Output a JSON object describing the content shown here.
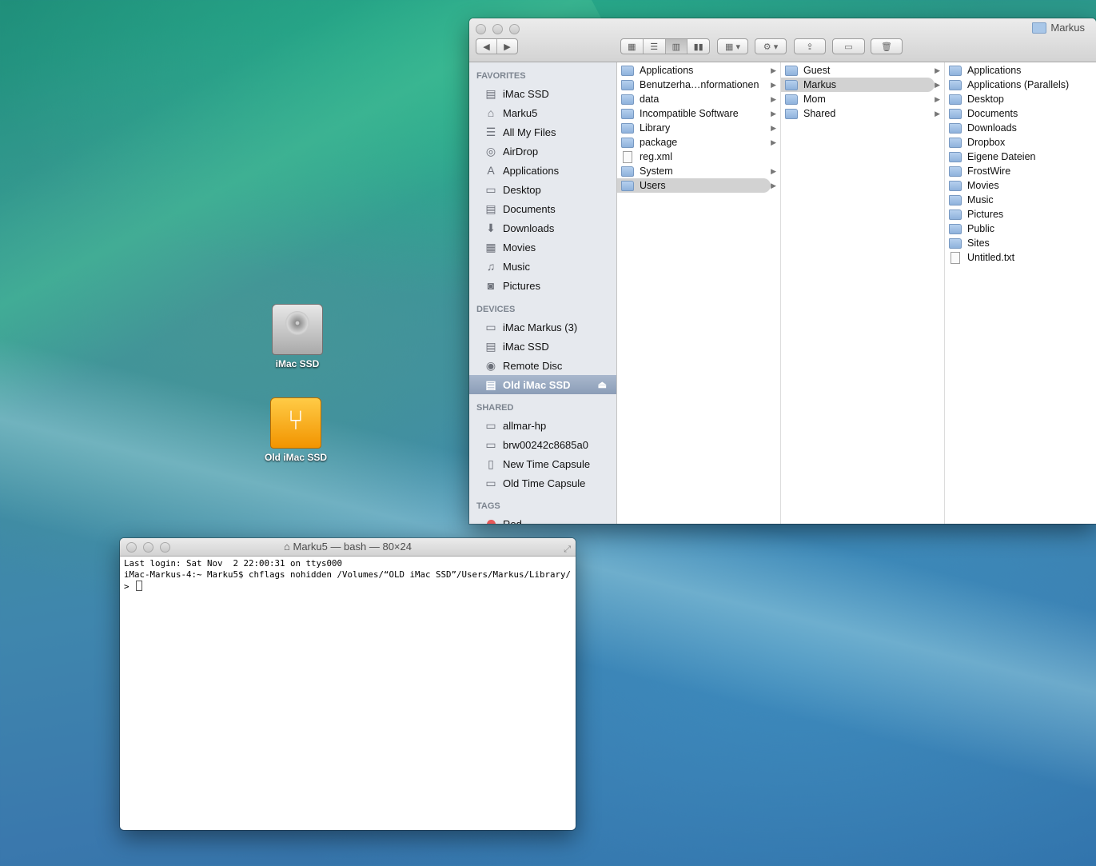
{
  "desktop": {
    "icons": [
      {
        "label": "iMac SSD",
        "kind": "hard-drive"
      },
      {
        "label": "Old iMac SSD",
        "kind": "usb-drive"
      }
    ]
  },
  "finder": {
    "title": "Markus",
    "toolbar": {
      "back": "◀",
      "forward": "▶",
      "views": [
        "icon-view",
        "list-view",
        "column-view",
        "coverflow-view"
      ],
      "active_view": "column-view",
      "arrange_icon": "▦",
      "action_icon": "⚙",
      "share_icon": "⇪",
      "tag_icon": "▭",
      "trash_icon": "🗑"
    },
    "sidebar": {
      "favorites_header": "FAVORITES",
      "favorites": [
        {
          "label": "iMac SSD",
          "icon": "internal-disk-icon",
          "glyph": "▤"
        },
        {
          "label": "Marku5",
          "icon": "home-icon",
          "glyph": "⌂"
        },
        {
          "label": "All My Files",
          "icon": "all-files-icon",
          "glyph": "☰"
        },
        {
          "label": "AirDrop",
          "icon": "airdrop-icon",
          "glyph": "◎"
        },
        {
          "label": "Applications",
          "icon": "applications-icon",
          "glyph": "A"
        },
        {
          "label": "Desktop",
          "icon": "desktop-icon",
          "glyph": "▭"
        },
        {
          "label": "Documents",
          "icon": "documents-icon",
          "glyph": "▤"
        },
        {
          "label": "Downloads",
          "icon": "downloads-icon",
          "glyph": "⬇"
        },
        {
          "label": "Movies",
          "icon": "movies-icon",
          "glyph": "▦"
        },
        {
          "label": "Music",
          "icon": "music-icon",
          "glyph": "♫"
        },
        {
          "label": "Pictures",
          "icon": "pictures-icon",
          "glyph": "◙"
        }
      ],
      "devices_header": "DEVICES",
      "devices": [
        {
          "label": "iMac Markus (3)",
          "icon": "imac-icon",
          "glyph": "▭"
        },
        {
          "label": "iMac SSD",
          "icon": "internal-disk-icon",
          "glyph": "▤"
        },
        {
          "label": "Remote Disc",
          "icon": "disc-icon",
          "glyph": "◉"
        },
        {
          "label": "Old iMac SSD",
          "icon": "external-disk-icon",
          "glyph": "▤",
          "selected": true,
          "eject": "⏏"
        }
      ],
      "shared_header": "SHARED",
      "shared": [
        {
          "label": "allmar-hp",
          "icon": "network-computer-icon",
          "glyph": "▭"
        },
        {
          "label": "brw00242c8685a0",
          "icon": "network-computer-icon",
          "glyph": "▭"
        },
        {
          "label": "New Time Capsule",
          "icon": "time-capsule-icon",
          "glyph": "▯"
        },
        {
          "label": "Old Time Capsule",
          "icon": "time-capsule-icon",
          "glyph": "▭"
        }
      ],
      "tags_header": "TAGS",
      "tags": [
        {
          "label": "Red",
          "color": "#e85a5a"
        }
      ]
    },
    "columns": [
      {
        "items": [
          {
            "label": "Applications",
            "type": "folder",
            "has_children": true
          },
          {
            "label": "Benutzerha…nformationen",
            "type": "folder-alias",
            "has_children": true
          },
          {
            "label": "data",
            "type": "folder",
            "has_children": true
          },
          {
            "label": "Incompatible Software",
            "type": "folder",
            "has_children": true
          },
          {
            "label": "Library",
            "type": "folder",
            "has_children": true
          },
          {
            "label": "package",
            "type": "folder",
            "has_children": true
          },
          {
            "label": "reg.xml",
            "type": "file",
            "has_children": false
          },
          {
            "label": "System",
            "type": "folder",
            "has_children": true
          },
          {
            "label": "Users",
            "type": "folder",
            "has_children": true,
            "selected": true
          }
        ]
      },
      {
        "items": [
          {
            "label": "Guest",
            "type": "folder",
            "has_children": true
          },
          {
            "label": "Markus",
            "type": "folder",
            "has_children": true,
            "selected": true
          },
          {
            "label": "Mom",
            "type": "folder",
            "has_children": true
          },
          {
            "label": "Shared",
            "type": "folder",
            "has_children": true
          }
        ]
      },
      {
        "items": [
          {
            "label": "Applications",
            "type": "folder"
          },
          {
            "label": "Applications (Parallels)",
            "type": "folder"
          },
          {
            "label": "Desktop",
            "type": "folder"
          },
          {
            "label": "Documents",
            "type": "folder"
          },
          {
            "label": "Downloads",
            "type": "folder"
          },
          {
            "label": "Dropbox",
            "type": "folder"
          },
          {
            "label": "Eigene Dateien",
            "type": "folder"
          },
          {
            "label": "FrostWire",
            "type": "folder"
          },
          {
            "label": "Movies",
            "type": "folder"
          },
          {
            "label": "Music",
            "type": "folder"
          },
          {
            "label": "Pictures",
            "type": "folder"
          },
          {
            "label": "Public",
            "type": "folder"
          },
          {
            "label": "Sites",
            "type": "folder"
          },
          {
            "label": "Untitled.txt",
            "type": "file"
          }
        ]
      }
    ]
  },
  "terminal": {
    "title": "Marku5 — bash — 80×24",
    "lines": [
      "Last login: Sat Nov  2 22:00:31 on ttys000",
      "iMac-Markus-4:~ Marku5$ chflags nohidden /Volumes/“OLD iMac SSD”/Users/Markus/Library/"
    ],
    "prompt": "> "
  }
}
